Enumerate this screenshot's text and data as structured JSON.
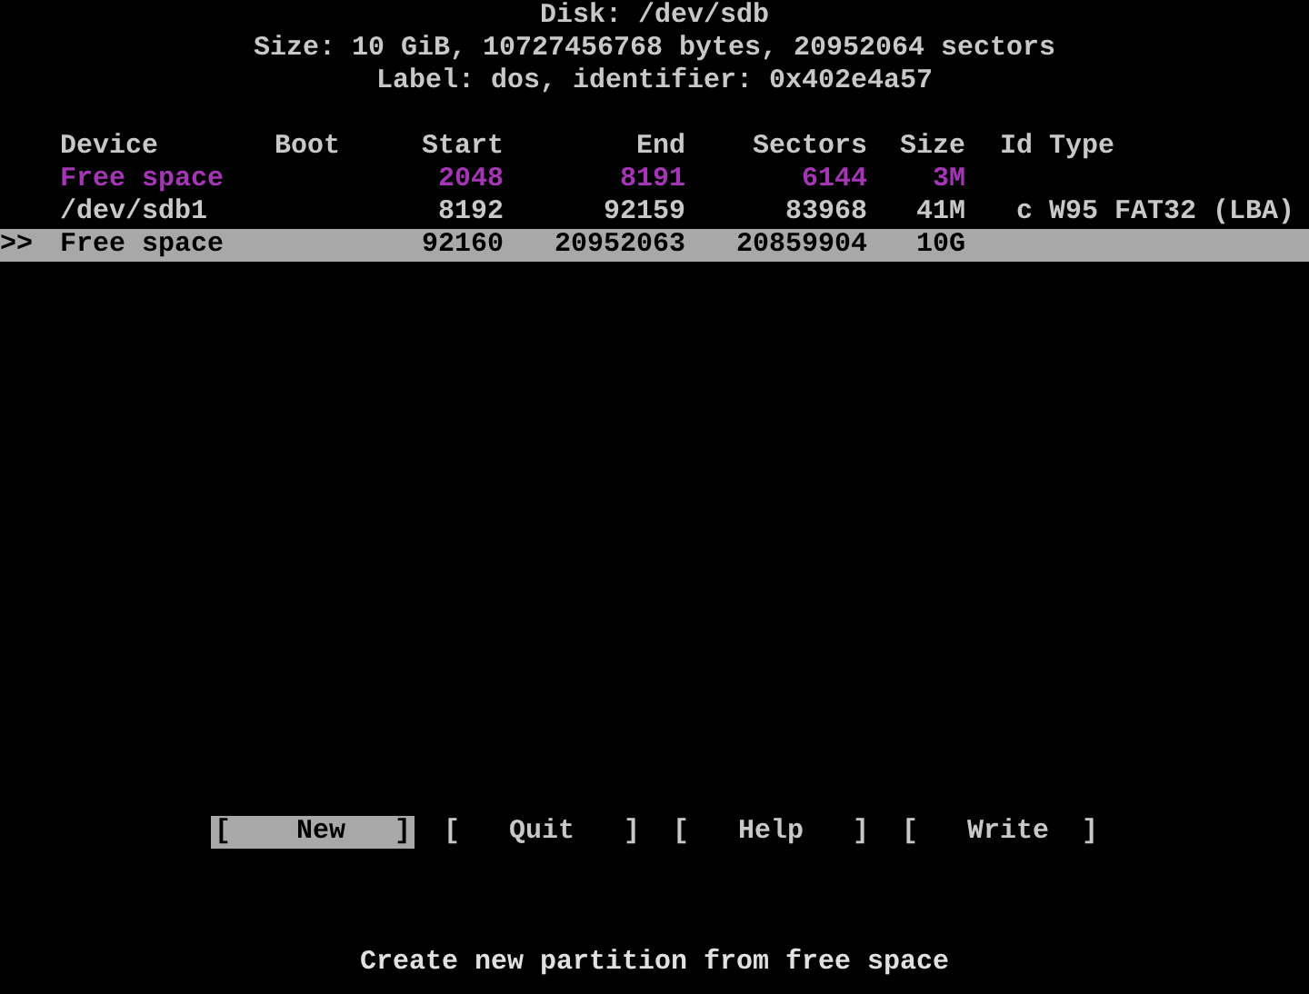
{
  "header": [
    "Disk: /dev/sdb",
    "Size: 10 GiB, 10727456768 bytes, 20952064 sectors",
    "Label: dos, identifier: 0x402e4a57"
  ],
  "table": {
    "cursor": ">>",
    "columns": [
      "Device",
      "Boot",
      "Start",
      "End",
      "Sectors",
      "Size",
      "Id",
      "Type"
    ],
    "rows": [
      {
        "kind": "free",
        "selected": false,
        "device": "Free space",
        "start": "2048",
        "end": "8191",
        "sectors": "6144",
        "size": "3M"
      },
      {
        "kind": "partition",
        "selected": false,
        "device": "/dev/sdb1",
        "start": "8192",
        "end": "92159",
        "sectors": "83968",
        "size": "41M",
        "id": "c",
        "type": "W95 FAT32 (LBA)"
      },
      {
        "kind": "free",
        "selected": true,
        "device": "Free space",
        "start": "92160",
        "end": "20952063",
        "sectors": "20859904",
        "size": "10G"
      }
    ]
  },
  "buttons": [
    {
      "label": "[    New   ]",
      "selected": true
    },
    {
      "label": "[   Quit   ]",
      "selected": false
    },
    {
      "label": "[   Help   ]",
      "selected": false
    },
    {
      "label": "[   Write  ]",
      "selected": false
    }
  ],
  "hint": "Create new partition from free space"
}
